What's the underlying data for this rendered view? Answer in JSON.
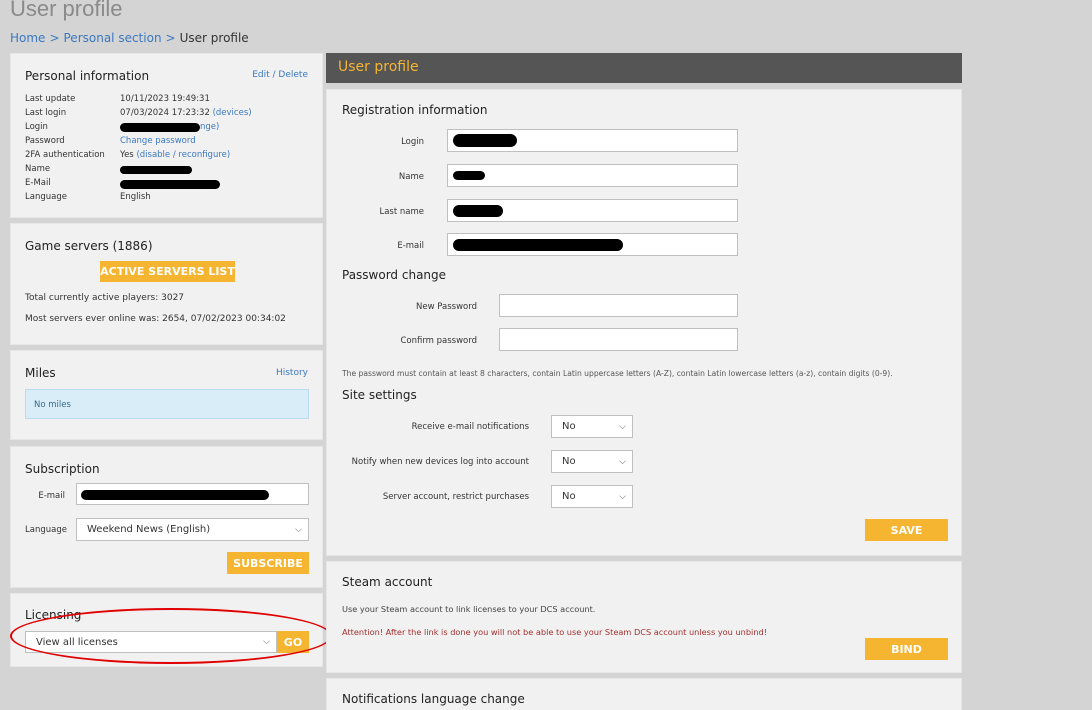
{
  "page": {
    "title": "User profile",
    "breadcrumb": [
      "Home",
      "Personal section",
      "User profile"
    ]
  },
  "personal_info": {
    "title": "Personal information",
    "actions": "Edit / Delete",
    "rows": [
      {
        "key": "Last update",
        "value": "10/11/2023 19:49:31"
      },
      {
        "key": "Last login",
        "value": "07/03/2024 17:23:32",
        "link": "(devices)"
      },
      {
        "key": "Login",
        "value": "",
        "link": "nge)"
      },
      {
        "key": "Password",
        "value": "",
        "link": "Change password"
      },
      {
        "key": "2FA authentication",
        "value": "Yes",
        "link": "(disable / reconfigure)"
      },
      {
        "key": "Name",
        "value": ""
      },
      {
        "key": "E-Mail",
        "value": ""
      },
      {
        "key": "Language",
        "value": "English"
      }
    ]
  },
  "game_servers": {
    "title": "Game servers (1886)",
    "button": "ACTIVE SERVERS LIST",
    "players": "Total currently active players: 3027",
    "record": "Most servers ever online was: 2654, 07/02/2023 00:34:02"
  },
  "miles": {
    "title": "Miles",
    "history": "History",
    "info": "No miles"
  },
  "subscription": {
    "title": "Subscription",
    "email_label": "E-mail",
    "language_label": "Language",
    "language_value": "Weekend News (English)",
    "button": "SUBSCRIBE"
  },
  "licensing": {
    "title": "Licensing",
    "select_value": "View all licenses",
    "button": "GO"
  },
  "user_profile": {
    "header": "User profile",
    "registration": {
      "title": "Registration information",
      "login": "Login",
      "name": "Name",
      "last_name": "Last name",
      "email": "E-mail"
    },
    "password": {
      "title": "Password change",
      "new": "New Password",
      "confirm": "Confirm password",
      "hint": "The password must contain at least 8 characters, contain Latin uppercase letters (A-Z), contain Latin lowercase letters (a-z), contain digits (0-9)."
    },
    "site": {
      "title": "Site settings",
      "notify_email": "Receive e-mail notifications",
      "notify_email_value": "No",
      "notify_devices": "Notify when new devices log into account",
      "notify_devices_value": "No",
      "restrict": "Server account, restrict purchases",
      "restrict_value": "No"
    },
    "save": "SAVE"
  },
  "steam": {
    "title": "Steam account",
    "desc": "Use your Steam account to link licenses to your DCS account.",
    "warning": "Attention! After the link is done you will not be able to use your Steam DCS account unless you unbind!",
    "button": "BIND"
  },
  "notifications": {
    "title": "Notifications language change"
  },
  "colors": {
    "accent": "#f6b530",
    "link": "#3a78c2",
    "warning": "#a33030",
    "annotation": "#e00000"
  }
}
